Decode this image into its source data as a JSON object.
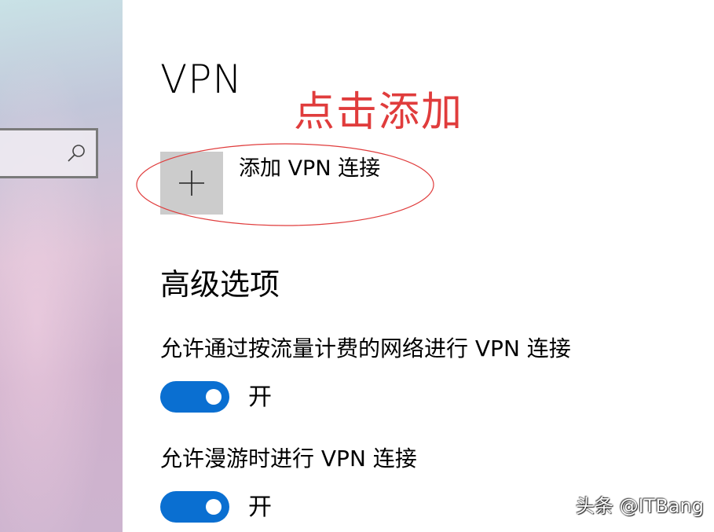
{
  "page": {
    "title": "VPN"
  },
  "annotation": {
    "text": "点击添加",
    "color": "#e03c3c"
  },
  "add_vpn": {
    "label": "添加 VPN 连接",
    "icon": "plus-icon"
  },
  "advanced": {
    "heading": "高级选项",
    "options": [
      {
        "label": "允许通过按流量计费的网络进行 VPN 连接",
        "toggle_on": true,
        "state_text": "开"
      },
      {
        "label": "允许漫游时进行 VPN 连接",
        "toggle_on": true,
        "state_text": "开"
      }
    ]
  },
  "sidebar": {
    "search_icon": "search-icon"
  },
  "colors": {
    "accent": "#0a6fd1",
    "tile": "#cccccc"
  },
  "watermark": {
    "text": "头条 @ITBang"
  }
}
